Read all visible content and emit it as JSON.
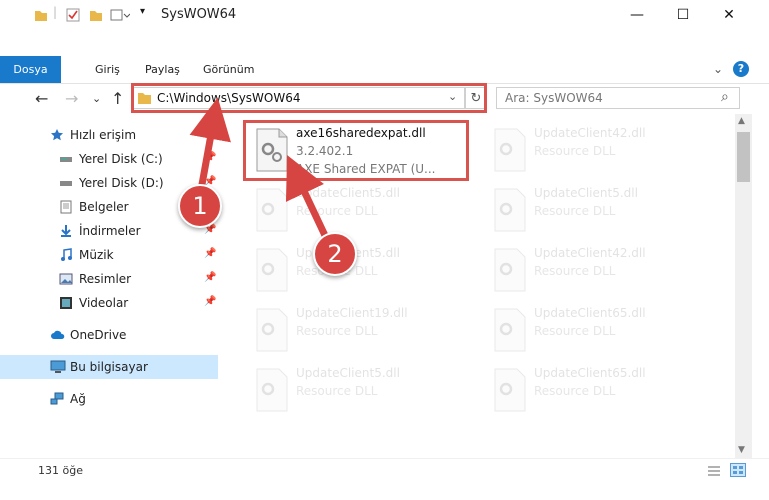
{
  "window": {
    "title": "SysWOW64",
    "minimize": "—",
    "maximize": "☐",
    "close": "✕"
  },
  "ribbon": {
    "tabs": [
      "Dosya",
      "Giriş",
      "Paylaş",
      "Görünüm"
    ],
    "expand": "⌄",
    "help": "?"
  },
  "address": {
    "path": "C:\\Windows\\SysWOW64",
    "search_placeholder": "Ara: SysWOW64",
    "back": "←",
    "forward": "→",
    "recent": "⌄",
    "up": "↑",
    "dropdown": "⌄",
    "refresh": "↻",
    "search_icon": "⌕"
  },
  "sidebar": {
    "items": [
      {
        "label": "Hızlı erişim",
        "icon": "star-icon"
      },
      {
        "label": "Yerel Disk (C:)",
        "icon": "drive-icon",
        "pinned": true
      },
      {
        "label": "Yerel Disk (D:)",
        "icon": "drive-icon",
        "pinned": true
      },
      {
        "label": "Belgeler",
        "icon": "documents-icon",
        "pinned": true
      },
      {
        "label": "İndirmeler",
        "icon": "downloads-icon",
        "pinned": true
      },
      {
        "label": "Müzik",
        "icon": "music-icon",
        "pinned": true
      },
      {
        "label": "Resimler",
        "icon": "pictures-icon",
        "pinned": true
      },
      {
        "label": "Videolar",
        "icon": "videos-icon",
        "pinned": true
      },
      {
        "label": "OneDrive",
        "icon": "cloud-icon"
      },
      {
        "label": "Bu bilgisayar",
        "icon": "computer-icon"
      },
      {
        "label": "Ağ",
        "icon": "network-icon"
      }
    ]
  },
  "files": {
    "highlighted": {
      "name": "axe16sharedexpat.dll",
      "version": "3.2.402.1",
      "description": "AXE Shared EXPAT (U..."
    },
    "background": [
      {
        "name": "UpdateClient42.dll",
        "type": "Resource DLL"
      },
      {
        "name": "UpdateClient5.dll",
        "type": "Resource DLL"
      },
      {
        "name": "UpdateClient5.dll",
        "type": "Resource DLL"
      },
      {
        "name": "UpdateClient5.dll",
        "type": "Resource DLL"
      },
      {
        "name": "UpdateClient42.dll",
        "type": "Resource DLL"
      },
      {
        "name": "UpdateClient19.dll",
        "type": "Resource DLL"
      },
      {
        "name": "UpdateClient65.dll",
        "type": "Resource DLL"
      },
      {
        "name": "UpdateClient5.dll",
        "type": "Resource DLL"
      },
      {
        "name": "UpdateClient65.dll",
        "type": "Resource DLL"
      }
    ]
  },
  "status": {
    "count": "131 öğe"
  },
  "annotations": {
    "step1": "1",
    "step2": "2"
  },
  "colors": {
    "accent": "#1979ca",
    "selected": "#cce8ff",
    "annotation_red": "#d64541"
  }
}
